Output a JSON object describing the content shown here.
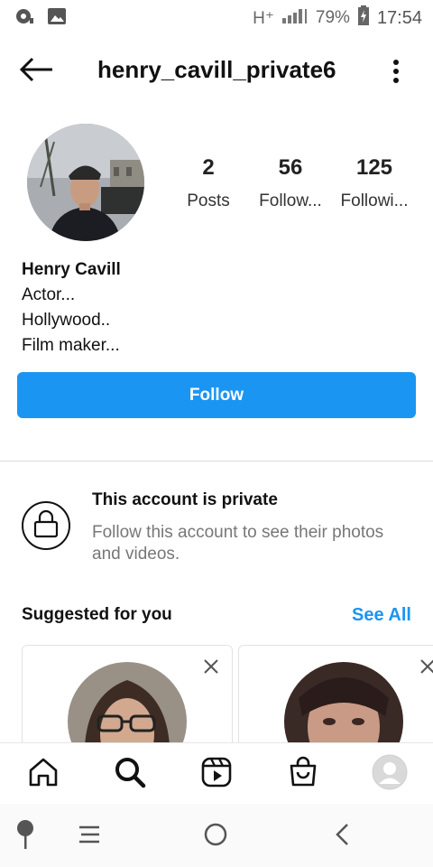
{
  "status_bar": {
    "network": "H⁺",
    "battery": "79%",
    "time": "17:54"
  },
  "header": {
    "username": "henry_cavill_private6"
  },
  "profile": {
    "stats": [
      {
        "value": "2",
        "label": "Posts"
      },
      {
        "value": "56",
        "label": "Follow..."
      },
      {
        "value": "125",
        "label": "Followi..."
      }
    ],
    "name": "Henry Cavill",
    "bio_lines": [
      "Actor...",
      "Hollywood..",
      "Film maker..."
    ],
    "follow_label": "Follow"
  },
  "private_notice": {
    "title": "This account is private",
    "description": "Follow this account to see their photos and videos."
  },
  "suggested": {
    "title": "Suggested for you",
    "see_all": "See All"
  },
  "colors": {
    "accent": "#1b95f2",
    "text": "#111111",
    "muted": "#777777"
  },
  "icons": {
    "back": "arrow-left-icon",
    "more": "more-vertical-icon",
    "lock": "lock-icon",
    "home": "home-icon",
    "search": "search-icon",
    "reels": "reels-icon",
    "shop": "shop-icon",
    "profile": "profile-avatar-icon"
  }
}
